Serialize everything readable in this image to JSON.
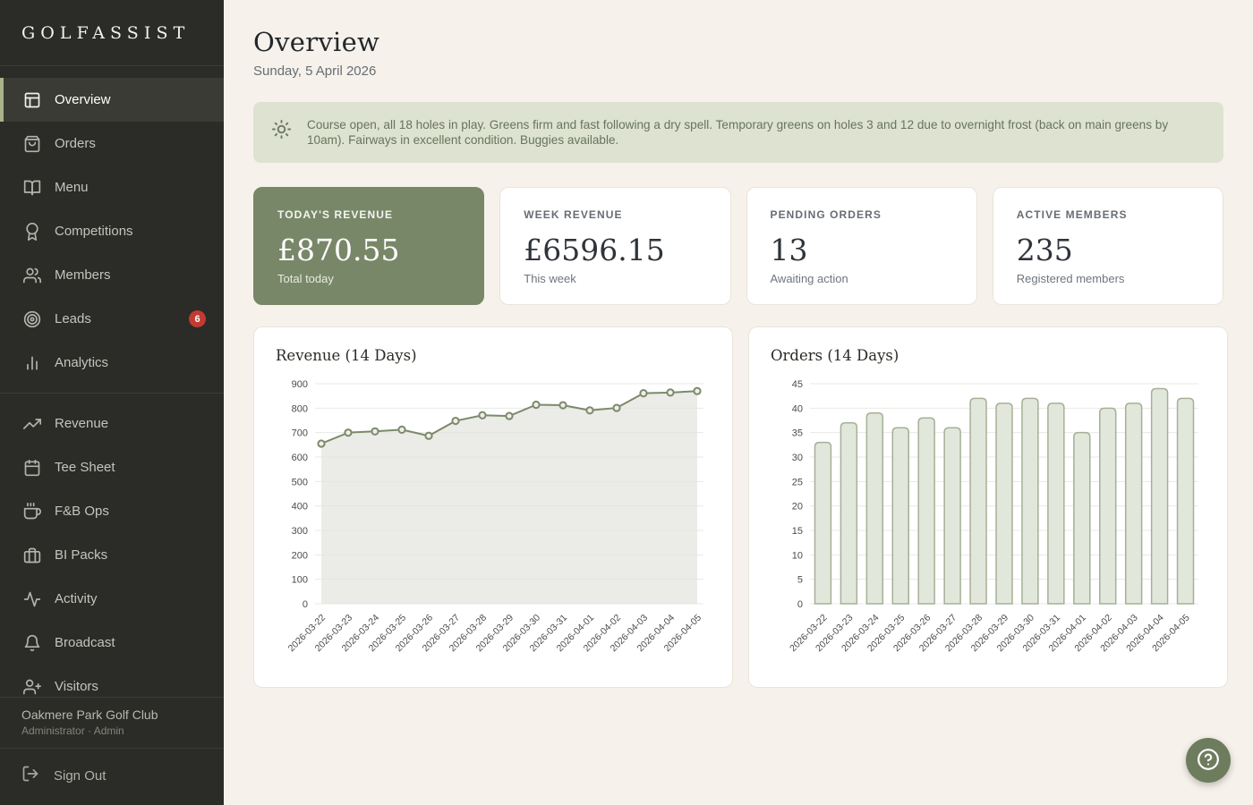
{
  "brand": "GOLFASSIST",
  "sidebar": {
    "items": [
      {
        "label": "Overview",
        "icon": "layout-icon",
        "active": true
      },
      {
        "label": "Orders",
        "icon": "shopping-bag-icon"
      },
      {
        "label": "Menu",
        "icon": "book-open-icon"
      },
      {
        "label": "Competitions",
        "icon": "award-icon"
      },
      {
        "label": "Members",
        "icon": "users-icon"
      },
      {
        "label": "Leads",
        "icon": "target-icon",
        "badge": "6"
      },
      {
        "label": "Analytics",
        "icon": "bar-chart-icon"
      },
      {
        "divider": true
      },
      {
        "label": "Revenue",
        "icon": "trending-up-icon"
      },
      {
        "label": "Tee Sheet",
        "icon": "calendar-icon"
      },
      {
        "label": "F&B Ops",
        "icon": "coffee-icon"
      },
      {
        "label": "BI Packs",
        "icon": "briefcase-icon"
      },
      {
        "label": "Activity",
        "icon": "activity-icon"
      },
      {
        "label": "Broadcast",
        "icon": "bell-icon"
      },
      {
        "label": "Visitors",
        "icon": "user-plus-icon"
      }
    ],
    "footer": {
      "org": "Oakmere Park Golf Club",
      "role": "Administrator · Admin",
      "sign_out": "Sign Out",
      "sign_out_icon": "log-out-icon"
    }
  },
  "header": {
    "title": "Overview",
    "date": "Sunday, 5 April 2026"
  },
  "notice": {
    "icon": "sun-icon",
    "text": "Course open, all 18 holes in play. Greens firm and fast following a dry spell. Temporary greens on holes 3 and 12 due to overnight frost (back on main greens by 10am). Fairways in excellent condition. Buggies available."
  },
  "stats": [
    {
      "label": "TODAY'S REVENUE",
      "value": "£870.55",
      "sub": "Total today",
      "highlight": true
    },
    {
      "label": "WEEK REVENUE",
      "value": "£6596.15",
      "sub": "This week"
    },
    {
      "label": "PENDING ORDERS",
      "value": "13",
      "sub": "Awaiting action"
    },
    {
      "label": "ACTIVE MEMBERS",
      "value": "235",
      "sub": "Registered members"
    }
  ],
  "chart_data": [
    {
      "type": "line",
      "title": "Revenue (14 Days)",
      "categories": [
        "2026-03-22",
        "2026-03-23",
        "2026-03-24",
        "2026-03-25",
        "2026-03-26",
        "2026-03-27",
        "2026-03-28",
        "2026-03-29",
        "2026-03-30",
        "2026-03-31",
        "2026-04-01",
        "2026-04-02",
        "2026-04-03",
        "2026-04-04",
        "2026-04-05"
      ],
      "values": [
        655,
        700,
        705,
        712,
        687,
        748,
        771,
        768,
        814,
        812,
        791,
        801,
        861,
        864,
        870
      ],
      "xlabel": "",
      "ylabel": "",
      "ylim": [
        0,
        900
      ],
      "ytick": 100,
      "grid": true,
      "legend": "none",
      "area_fill": true
    },
    {
      "type": "bar",
      "title": "Orders (14 Days)",
      "categories": [
        "2026-03-22",
        "2026-03-23",
        "2026-03-24",
        "2026-03-25",
        "2026-03-26",
        "2026-03-27",
        "2026-03-28",
        "2026-03-29",
        "2026-03-30",
        "2026-03-31",
        "2026-04-01",
        "2026-04-02",
        "2026-04-03",
        "2026-04-04",
        "2026-04-05"
      ],
      "values": [
        33,
        37,
        39,
        36,
        38,
        36,
        42,
        41,
        42,
        41,
        35,
        40,
        41,
        44,
        42
      ],
      "xlabel": "",
      "ylabel": "",
      "ylim": [
        0,
        45
      ],
      "ytick": 5,
      "grid": true,
      "legend": "none"
    }
  ],
  "help_button": {
    "icon": "help-circle-icon"
  },
  "colors": {
    "accent_sage": "#798769",
    "sidebar_bg": "#2b2b27",
    "active_border": "#a8b38c",
    "badge_red": "#c23b31",
    "notice_bg": "#dde2d1",
    "notice_text": "#68745c",
    "page_bg": "#f6f2eb",
    "line": "#7c8a6b",
    "area_fill": "#e6e6e2",
    "bar_fill": "#e2e7db",
    "bar_stroke": "#a6b097",
    "grid": "#e8e8e4",
    "help_fab": "#6e7c5e"
  }
}
